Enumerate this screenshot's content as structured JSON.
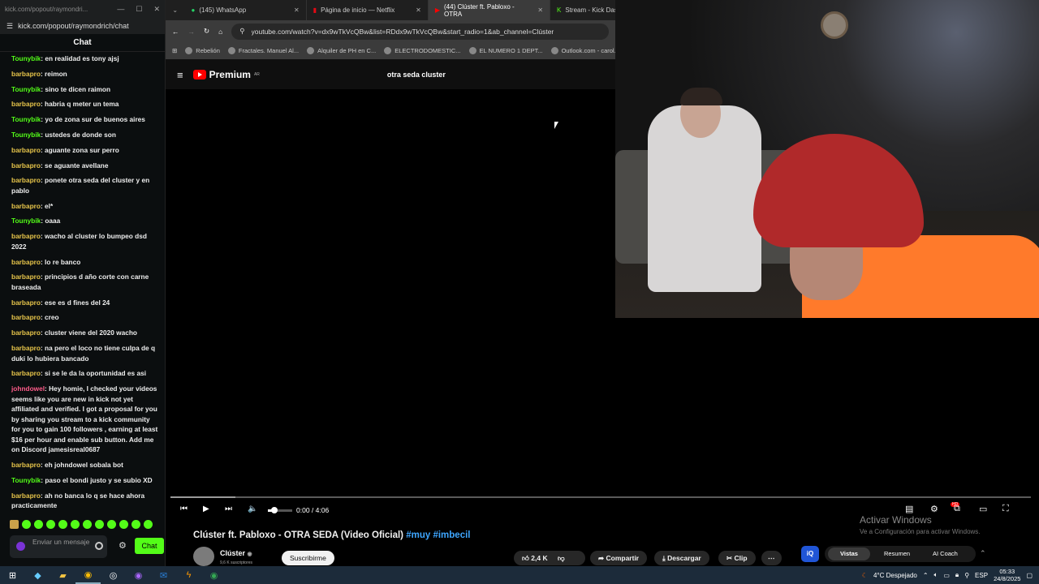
{
  "kick": {
    "tab_title": "kick.com/popout/raymondri...",
    "url": "kick.com/popout/raymondrich/chat",
    "chat_title": "Chat",
    "messages": [
      {
        "user": "Tounybik",
        "color": "#53fc18",
        "text": "en realidad es tony ajsj"
      },
      {
        "user": "barbapro",
        "color": "#e6c44a",
        "text": "reimon"
      },
      {
        "user": "Tounybik",
        "color": "#53fc18",
        "text": "sino te dicen raimon"
      },
      {
        "user": "barbapro",
        "color": "#e6c44a",
        "text": "habria q meter un tema"
      },
      {
        "user": "Tounybik",
        "color": "#53fc18",
        "text": "yo de zona sur de buenos aires"
      },
      {
        "user": "Tounybik",
        "color": "#53fc18",
        "text": "ustedes de donde son"
      },
      {
        "user": "barbapro",
        "color": "#e6c44a",
        "text": "aguante zona sur perro"
      },
      {
        "user": "barbapro",
        "color": "#e6c44a",
        "text": "se aguante avellane"
      },
      {
        "user": "barbapro",
        "color": "#e6c44a",
        "text": "ponete otra seda del cluster y en pablo"
      },
      {
        "user": "barbapro",
        "color": "#e6c44a",
        "text": "el*"
      },
      {
        "user": "Tounybik",
        "color": "#53fc18",
        "text": "oaaa"
      },
      {
        "user": "barbapro",
        "color": "#e6c44a",
        "text": "wacho al cluster lo bumpeo dsd 2022"
      },
      {
        "user": "barbapro",
        "color": "#e6c44a",
        "text": "lo re banco"
      },
      {
        "user": "barbapro",
        "color": "#e6c44a",
        "text": "principios d año corte con carne braseada"
      },
      {
        "user": "barbapro",
        "color": "#e6c44a",
        "text": "ese es d fines del 24"
      },
      {
        "user": "barbapro",
        "color": "#e6c44a",
        "text": "creo"
      },
      {
        "user": "barbapro",
        "color": "#e6c44a",
        "text": "cluster viene del 2020 wacho"
      },
      {
        "user": "barbapro",
        "color": "#e6c44a",
        "text": "na pero el loco no tiene culpa de q duki lo hubiera bancado"
      },
      {
        "user": "barbapro",
        "color": "#e6c44a",
        "text": "si se le da la oportunidad es asi"
      },
      {
        "user": "johndowel",
        "color": "#ff5c8a",
        "text": "Hey homie, I checked your videos seems like you are new in kick not yet affiliated and verified. I got a proposal for you by sharing you stream to a kick community for you to gain 100 followers , earning at least $16 per hour and enable sub button. Add me on Discord jamesisreal0687"
      },
      {
        "user": "barbapro",
        "color": "#e6c44a",
        "text": "eh johndowel sobala bot"
      },
      {
        "user": "Tounybik",
        "color": "#53fc18",
        "text": "paso el bondi justo y se subio XD"
      },
      {
        "user": "barbapro",
        "color": "#e6c44a",
        "text": "ah no banca lo q se hace ahora practicamente"
      }
    ],
    "input_placeholder": "Enviar un mensaje",
    "chat_button": "Chat"
  },
  "browser": {
    "tabs": [
      {
        "label": "(145) WhatsApp"
      },
      {
        "label": "Página de inicio — Netflix"
      },
      {
        "label": "(44) Clúster ft. Pabloxo - OTRA"
      },
      {
        "label": "Stream - Kick Dashb"
      }
    ],
    "url": "youtube.com/watch?v=dx9wTkVcQBw&list=RDdx9wTkVcQBw&start_radio=1&ab_channel=Clúster",
    "bookmarks": [
      "Rebelión",
      "Fractales. Manuel Al...",
      "Alquiler de PH en C...",
      "ELECTRODOMESTIC...",
      "EL NUMERO 1 DEPT...",
      "Outlook.com - carol..."
    ]
  },
  "youtube": {
    "logo": "Premium",
    "country": "AR",
    "search": "otra seda cluster",
    "time": "0:00 / 4:06",
    "progress_fraction": 0.075,
    "volume_fraction": 0.25,
    "title": "Clúster ft. Pabloxo - OTRA SEDA (Video Oficial)",
    "tag1": "#muy",
    "tag2": "#imbecil",
    "channel": "Clúster",
    "subs": "9,6 K suscriptores",
    "subscribe": "Suscribirme",
    "likes": "2,4 K",
    "share": "Compartir",
    "download": "Descargar",
    "clip": "Clip",
    "iq": "iQ",
    "pill": [
      "Vistas",
      "Resumen",
      "AI Coach"
    ]
  },
  "watermark": {
    "line1": "Activar Windows",
    "line2": "Ve a Configuración para activar Windows."
  },
  "taskbar": {
    "weather": "4°C Despejado",
    "lang": "ESP",
    "time": "05:33",
    "date": "24/8/2025"
  }
}
